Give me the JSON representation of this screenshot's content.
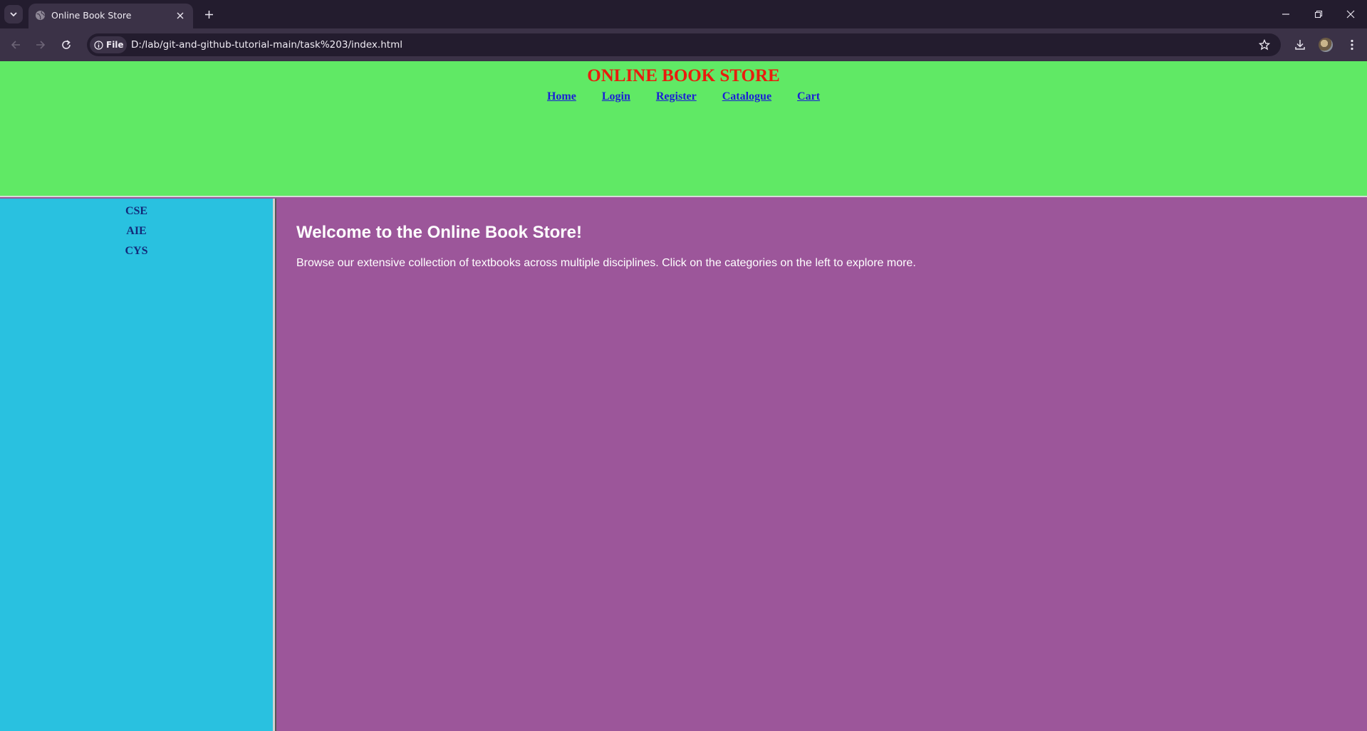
{
  "browser": {
    "tab_title": "Online Book Store",
    "site_chip_label": "File",
    "url": "D:/lab/git-and-github-tutorial-main/task%203/index.html"
  },
  "header": {
    "title": "ONLINE BOOK STORE",
    "nav": [
      "Home",
      "Login",
      "Register",
      "Catalogue",
      "Cart"
    ]
  },
  "sidebar": {
    "items": [
      "CSE",
      "AIE",
      "CYS"
    ]
  },
  "main": {
    "heading": "Welcome to the Online Book Store!",
    "body": "Browse our extensive collection of textbooks across multiple disciplines. Click on the categories on the left to explore more."
  },
  "colors": {
    "header_bg": "#60e965",
    "title": "#ea1c0d",
    "nav_link": "#1a1fd6",
    "sidebar_bg": "#29c1e0",
    "sidebar_text": "#132a7a",
    "main_bg": "#9c569a"
  },
  "icons": [
    "tab-list-icon",
    "globe-icon",
    "close-icon",
    "plus-icon",
    "minimize-icon",
    "restore-icon",
    "window-close-icon",
    "back-icon",
    "forward-icon",
    "reload-icon",
    "info-icon",
    "star-icon",
    "download-icon",
    "avatar",
    "more-icon"
  ]
}
